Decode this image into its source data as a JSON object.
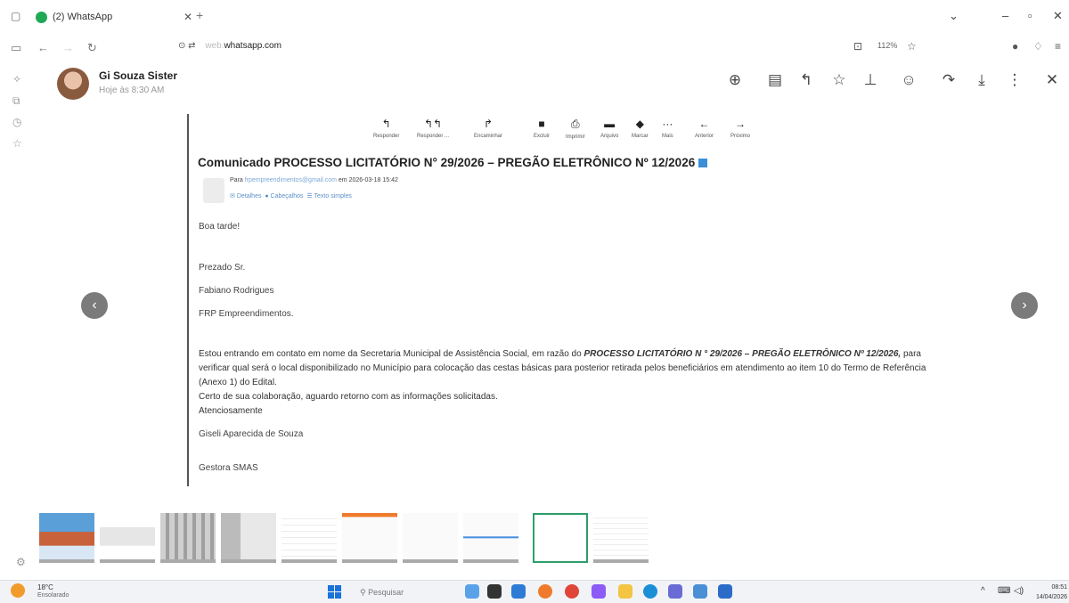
{
  "browser": {
    "tab_title": "(2) WhatsApp",
    "url_prefix": "web.",
    "url_domain": "whatsapp.com",
    "zoom": "112%"
  },
  "viewer": {
    "sender_name": "Gi Souza Sister",
    "sent_time": "Hoje às 8:30 AM"
  },
  "email": {
    "toolbar": [
      {
        "label": "Responder",
        "icon": "reply-icon"
      },
      {
        "label": "Responder ...",
        "icon": "reply-all-icon"
      },
      {
        "label": "Encaminhar",
        "icon": "forward-icon"
      },
      {
        "label": "Excluir",
        "icon": "trash-icon"
      },
      {
        "label": "Imprimir",
        "icon": "print-icon"
      },
      {
        "label": "Arquivo",
        "icon": "archive-icon"
      },
      {
        "label": "Marcar",
        "icon": "tag-icon"
      },
      {
        "label": "Mais",
        "icon": "more-icon"
      },
      {
        "label": "Anterior",
        "icon": "arrow-left-icon"
      },
      {
        "label": "Próximo",
        "icon": "arrow-right-icon"
      }
    ],
    "subject": "Comunicado PROCESSO LICITATÓRIO N° 29/2026 – PREGÃO ELETRÔNICO Nº 12/2026",
    "to_prefix": "Para",
    "to_address": "frpempreendimentos@gmail.com",
    "date_prefix": "em",
    "date": "2026-03-18 15:42",
    "links": [
      "Detalhes",
      "Cabeçalhos",
      "Texto simples"
    ],
    "greeting": "Boa tarde!",
    "salutation": "Prezado Sr.",
    "recipient_name": "Fabiano Rodrigues",
    "recipient_company": "FRP Empreendimentos.",
    "para_part1": "Estou entrando em contato em nome da Secretaria Municipal de Assistência Social, em razão do ",
    "para_bold": "PROCESSO LICITATÓRIO N ° 29/2026 – PREGÃO ELETRÔNICO Nº 12/2026,",
    "para_part2": " para verificar qual será o local disponibilizado no Município para colocação das cestas básicas para posterior retirada pelos beneficiários em atendimento ao item 10 do Termo de Referência (Anexo 1) do Edital.",
    "closing_line": "Certo de sua colaboração, aguardo retorno com as informações solicitadas.",
    "closing": "Atenciosamente",
    "signature_name": "Giseli Aparecida de Souza",
    "signature_role": "Gestora SMAS"
  },
  "taskbar": {
    "temperature": "18°C",
    "weather": "Ensolarado",
    "search_placeholder": "Pesquisar",
    "time": "08:51",
    "date": "14/04/2026"
  },
  "colors": {
    "whatsapp_green": "#1fa855",
    "selected_thumb": "#2e9e6a",
    "link_blue": "#5b8fc9"
  }
}
